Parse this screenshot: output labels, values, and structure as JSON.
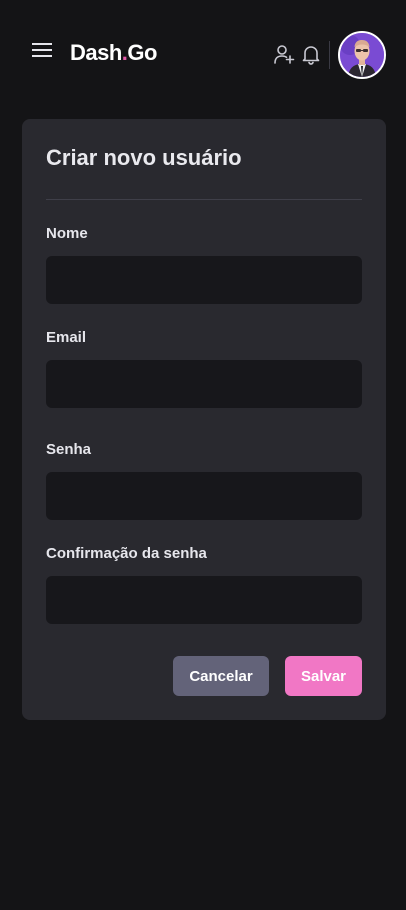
{
  "header": {
    "menu_icon": "hamburger-menu-icon",
    "brand_name": "Dash",
    "brand_dot": ".",
    "brand_suffix": "Go",
    "brand_accent_color": "#e559a9",
    "icons": [
      "user-add-icon",
      "bell-icon"
    ],
    "avatar_icon": "user-avatar"
  },
  "form": {
    "title": "Criar novo usuário",
    "fields": [
      {
        "label": "Nome",
        "value": ""
      },
      {
        "label": "Email",
        "value": ""
      },
      {
        "label": "Senha",
        "value": ""
      },
      {
        "label": "Confirmação da senha",
        "value": ""
      }
    ],
    "cancel_label": "Cancelar",
    "save_label": "Salvar"
  },
  "colors": {
    "background": "#141416",
    "card": "#29292f",
    "input": "#17171b",
    "cancel_button": "#636379",
    "save_button": "#f177c5"
  }
}
